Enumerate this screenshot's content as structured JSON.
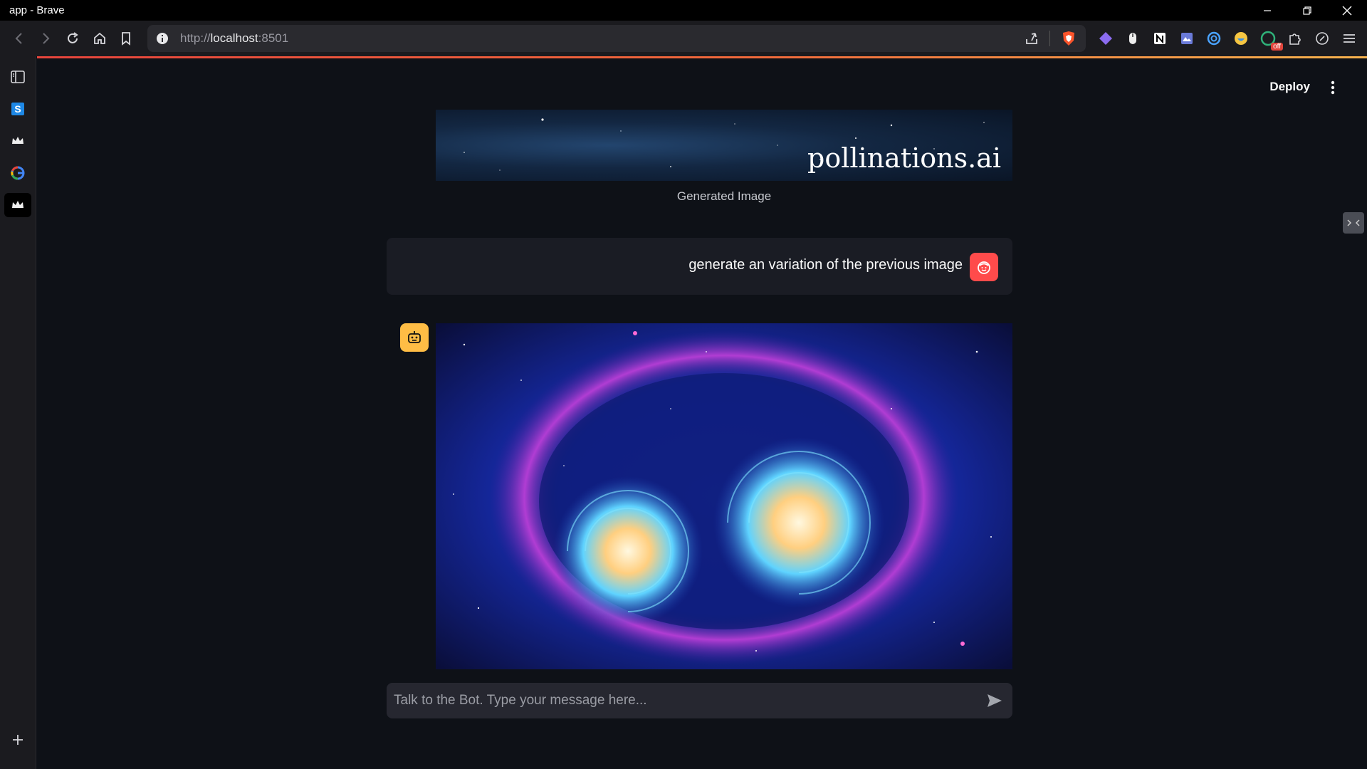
{
  "window": {
    "title": "app - Brave"
  },
  "browser": {
    "url_scheme": "http://",
    "url_host": "localhost",
    "url_port": ":8501",
    "extension_badge": "off"
  },
  "header": {
    "deploy_label": "Deploy"
  },
  "banner": {
    "brand_text": "pollinations.ai",
    "caption": "Generated Image"
  },
  "chat": {
    "user_message": "generate an variation of the previous image",
    "input_placeholder": "Talk to the Bot. Type your message here..."
  },
  "colors": {
    "app_bg": "#0e1117",
    "user_avatar": "#ff4b4b",
    "bot_avatar": "#ffbd45",
    "input_bg": "#262730"
  },
  "icons": [
    "back-icon",
    "forward-icon",
    "reload-icon",
    "home-icon",
    "bookmark-icon",
    "info-icon",
    "share-icon",
    "brave-shield-icon",
    "sidebar-toggle-icon",
    "send-icon",
    "robot-icon",
    "user-face-icon",
    "kebab-menu-icon",
    "plus-icon"
  ]
}
